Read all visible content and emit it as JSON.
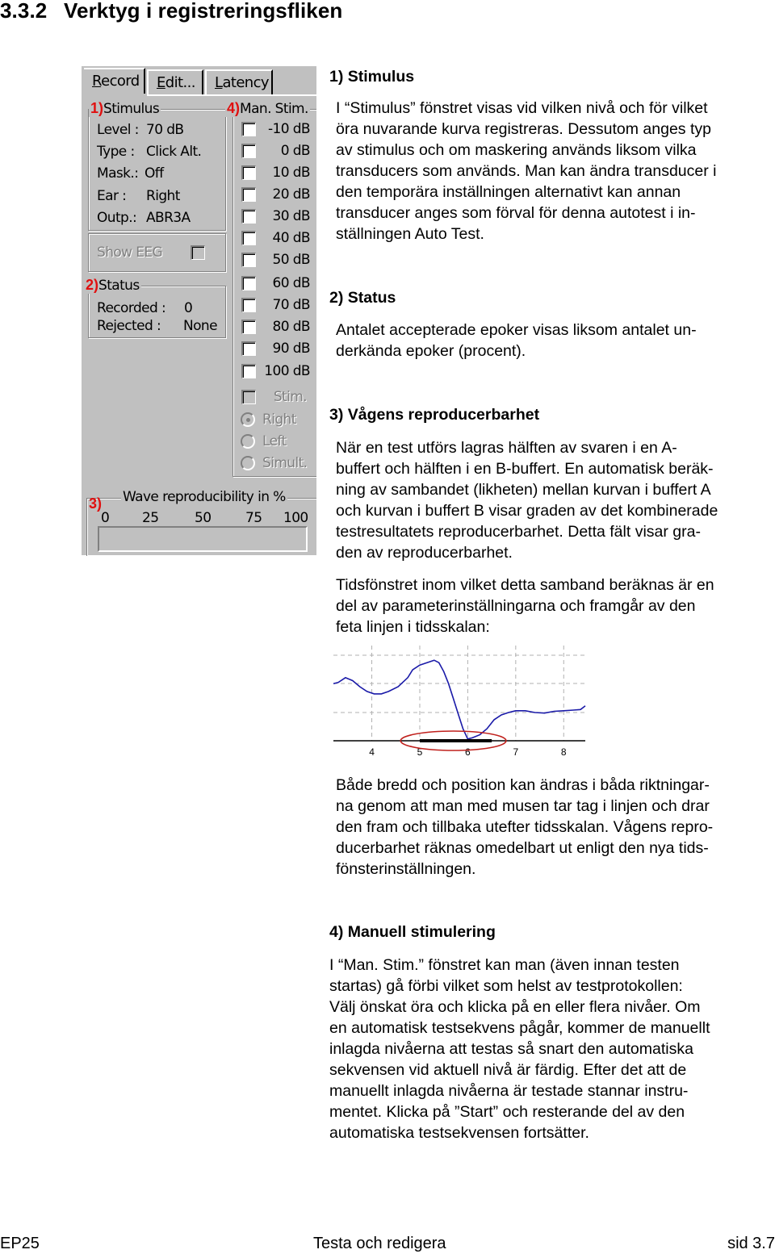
{
  "page": {
    "section_number": "3.3.2",
    "section_title": "Verktyg i registreringsfliken"
  },
  "panel": {
    "tabs": [
      {
        "acc": "R",
        "rest": "ecord",
        "active": true
      },
      {
        "acc": "E",
        "rest": "dit...",
        "active": false
      },
      {
        "acc": "L",
        "rest": "atency",
        "active": false
      }
    ],
    "stimulus": {
      "marker": "1)",
      "title": "Stimulus",
      "rows": [
        {
          "key": "Level :",
          "value": "70 dB"
        },
        {
          "key": "Type :",
          "value": "Click Alt."
        },
        {
          "key": "Mask.:",
          "value": "Off"
        },
        {
          "key": "Ear :",
          "value": "Right"
        },
        {
          "key": "Outp.:",
          "value": "ABR3A"
        }
      ]
    },
    "show_eeg": {
      "label": "Show EEG",
      "checked": false,
      "enabled": false
    },
    "status": {
      "marker": "2)",
      "title": "Status",
      "recorded_label": "Recorded :",
      "recorded_value": "0",
      "rejected_label": "Rejected :",
      "rejected_value": "None"
    },
    "man_stim": {
      "marker": "4)",
      "title": "Man. Stim.",
      "levels": [
        "-10 dB",
        "0 dB",
        "10 dB",
        "20 dB",
        "30 dB",
        "40 dB",
        "50 dB",
        "60 dB",
        "70 dB",
        "80 dB",
        "90 dB",
        "100 dB"
      ],
      "stim_label": "Stim.",
      "ears": [
        {
          "label": "Right",
          "selected": true
        },
        {
          "label": "Left",
          "selected": false
        },
        {
          "label": "Simult.",
          "selected": false
        }
      ]
    },
    "reproducibility": {
      "marker": "3)",
      "title": "Wave reproducibility in %",
      "scale": [
        "0",
        "25",
        "50",
        "75",
        "100"
      ],
      "value_percent": 0
    }
  },
  "sections": [
    {
      "heading": "1) Stimulus",
      "paragraphs": [
        [
          "I “Stimulus” fönstret visas vid vilken nivå och för vilket",
          "öra nuvarande kurva registreras. Dessutom anges typ",
          "av stimulus och om maskering används liksom vilka",
          "transducers som används. Man kan ändra transducer i",
          "den temporära inställningen alternativt kan annan",
          "transducer anges som förval för denna autotest i in-",
          "ställningen Auto Test."
        ]
      ]
    },
    {
      "heading": "2) Status",
      "paragraphs": [
        [
          "Antalet accepterade epoker visas liksom antalet un-",
          "derkända epoker (procent)."
        ]
      ]
    },
    {
      "heading": "3) Vågens reproducerbarhet",
      "paragraphs": [
        [
          "När en test utförs lagras hälften av svaren i en A-",
          "buffert och hälften i en B-buffert. En automatisk beräk-",
          "ning av sambandet (likheten) mellan kurvan i buffert A",
          "och kurvan i buffert B visar graden av det kombinerade",
          "testresultatets reproducerbarhet. Detta fält visar gra-",
          "den av reproducerbarhet."
        ],
        [
          "Tidsfönstret inom vilket detta samband beräknas är en",
          "del av parameterinställningarna och framgår av den",
          "feta linjen i tidsskalan:"
        ],
        [
          "Både bredd och position kan ändras i båda riktningar-",
          "na genom att man med musen tar tag i linjen och drar",
          "den fram och tillbaka utefter tidsskalan. Vågens repro-",
          "ducerbarhet räknas omedelbart ut enligt den nya tids-",
          "fönsterinställningen."
        ]
      ]
    },
    {
      "heading": "4) Manuell stimulering",
      "paragraphs": [
        [
          "I “Man. Stim.” fönstret kan man (även innan testen",
          "startas) gå förbi vilket som helst av testprotokollen:",
          "Välj önskat öra och klicka på en eller flera nivåer. Om",
          "en automatisk testsekvens pågår, kommer de manuellt",
          "inlagda nivåerna att testas så snart den automatiska",
          "sekvensen vid aktuell nivå är färdig. Efter det att de",
          "manuellt inlagda nivåerna är testade stannar instru-",
          "mentet. Klicka på ”Start” och resterande del av den",
          "automatiska testsekvensen fortsätter."
        ]
      ]
    }
  ],
  "chart_data": {
    "type": "line",
    "title": "",
    "xlabel": "",
    "ylabel": "",
    "xlim": [
      3.2,
      8.45
    ],
    "ylim": [
      0,
      1.2
    ],
    "grid": true,
    "x_ticks": [
      4,
      5,
      6,
      7,
      8
    ],
    "x_tick_labels": [
      "4",
      "5",
      "6",
      "7",
      "8"
    ],
    "series": [
      {
        "name": "waveform",
        "color": "#1a1aa8",
        "x": [
          3.2,
          3.3,
          3.45,
          3.6,
          3.75,
          3.9,
          4.05,
          4.2,
          4.35,
          4.55,
          4.75,
          4.85,
          5.0,
          5.15,
          5.3,
          5.4,
          5.5,
          5.6,
          5.7,
          5.8,
          5.9,
          6.0,
          6.1,
          6.25,
          6.4,
          6.55,
          6.7,
          6.85,
          7.0,
          7.2,
          7.4,
          7.6,
          7.8,
          8.0,
          8.2,
          8.35,
          8.45
        ],
        "y": [
          0.95,
          0.97,
          1.05,
          1.0,
          0.9,
          0.82,
          0.78,
          0.78,
          0.82,
          0.9,
          1.05,
          1.18,
          1.26,
          1.3,
          1.34,
          1.3,
          1.15,
          0.95,
          0.7,
          0.45,
          0.2,
          0.03,
          0.05,
          0.1,
          0.2,
          0.35,
          0.43,
          0.47,
          0.5,
          0.5,
          0.47,
          0.46,
          0.49,
          0.5,
          0.51,
          0.52,
          0.58
        ]
      }
    ],
    "annotations": [
      {
        "type": "time-window-bar",
        "x_start": 5.0,
        "x_end": 6.5,
        "color": "#000000"
      },
      {
        "type": "highlight-ellipse",
        "x_start": 4.6,
        "x_end": 6.8,
        "color": "#c0201c"
      }
    ]
  },
  "footer": {
    "left": "EP25",
    "center": "Testa och redigera",
    "right": "sid 3.7"
  }
}
